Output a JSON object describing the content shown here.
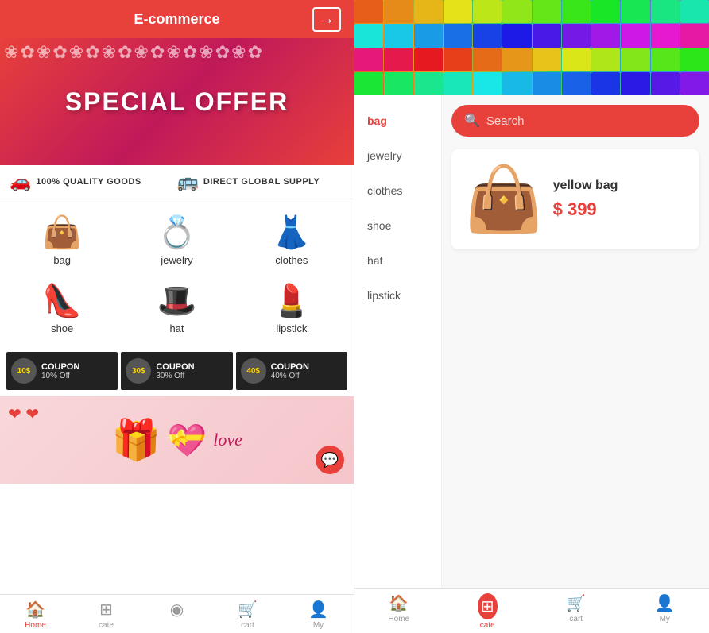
{
  "app": {
    "title": "E-commerce",
    "left_nav": [
      {
        "label": "Home",
        "icon": "🏠",
        "active": true
      },
      {
        "label": "cate",
        "icon": "⊞",
        "active": false
      },
      {
        "label": "",
        "icon": "●",
        "active": false
      },
      {
        "label": "cart",
        "icon": "🛒",
        "active": false
      },
      {
        "label": "My",
        "icon": "👤",
        "active": false
      }
    ],
    "right_nav": [
      {
        "label": "Home",
        "icon": "🏠",
        "active": false
      },
      {
        "label": "cate",
        "icon": "⊞",
        "active": true
      },
      {
        "label": "cart",
        "icon": "🛒",
        "active": false
      },
      {
        "label": "My",
        "icon": "👤",
        "active": false
      }
    ]
  },
  "banner": {
    "text": "SPECIAL OFFER"
  },
  "info_bar": [
    {
      "icon": "🚗",
      "text": "100% QUALITY GOODS"
    },
    {
      "icon": "🚌",
      "text": "DIRECT GLOBAL SUPPLY"
    }
  ],
  "categories": [
    {
      "label": "bag",
      "emoji": "👜"
    },
    {
      "label": "jewelry",
      "emoji": "💍"
    },
    {
      "label": "clothes",
      "emoji": "👗"
    },
    {
      "label": "shoe",
      "emoji": "👠"
    },
    {
      "label": "hat",
      "emoji": "🎩"
    },
    {
      "label": "lipstick",
      "emoji": "💄"
    }
  ],
  "coupons": [
    {
      "number": "10$",
      "title": "COUPON",
      "off": "10% Off"
    },
    {
      "number": "30$",
      "title": "COUPON",
      "off": "30% Off"
    },
    {
      "number": "40$",
      "title": "COUPON",
      "off": "40% Off"
    }
  ],
  "search": {
    "placeholder": "Search"
  },
  "sidebar_categories": [
    {
      "label": "bag",
      "active": true
    },
    {
      "label": "jewelry",
      "active": false
    },
    {
      "label": "clothes",
      "active": false
    },
    {
      "label": "shoe",
      "active": false
    },
    {
      "label": "hat",
      "active": false
    },
    {
      "label": "lipstick",
      "active": false
    }
  ],
  "product": {
    "name": "yellow bag",
    "price": "$ 399",
    "emoji": "👜"
  },
  "mosaic_colors": [
    "#e74c3c",
    "#f39c12",
    "#2ecc71",
    "#3498db",
    "#9b59b6",
    "#e74c3c",
    "#f39c12",
    "#2ecc71",
    "#3498db",
    "#9b59b6",
    "#e74c3c",
    "#f39c12",
    "#f39c12",
    "#2ecc71",
    "#3498db",
    "#9b59b6",
    "#e74c3c",
    "#f39c12",
    "#2ecc71",
    "#3498db",
    "#9b59b6",
    "#e74c3c",
    "#f39c12",
    "#2ecc71",
    "#2ecc71",
    "#3498db",
    "#9b59b6",
    "#e74c3c",
    "#f39c12",
    "#2ecc71",
    "#3498db",
    "#9b59b6",
    "#e74c3c",
    "#f39c12",
    "#2ecc71",
    "#3498db",
    "#3498db",
    "#9b59b6",
    "#e74c3c",
    "#f39c12",
    "#2ecc71",
    "#3498db",
    "#9b59b6",
    "#e74c3c",
    "#f39c12",
    "#2ecc71",
    "#3498db",
    "#9b59b6"
  ]
}
